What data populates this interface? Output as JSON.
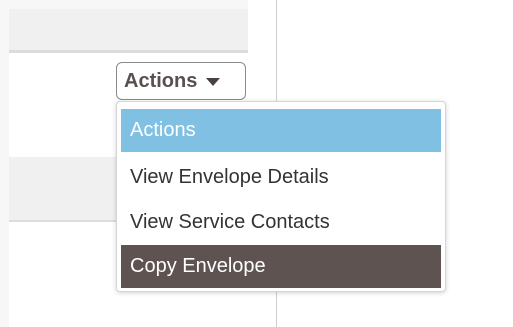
{
  "actions_button": {
    "label": "Actions"
  },
  "menu": {
    "items": [
      {
        "label": "Actions",
        "state": "highlighted"
      },
      {
        "label": "View Envelope Details",
        "state": "normal"
      },
      {
        "label": "View Service Contacts",
        "state": "normal"
      },
      {
        "label": "Copy Envelope",
        "state": "selected"
      }
    ]
  },
  "colors": {
    "highlight": "#7fc0e3",
    "selected": "#5f5352",
    "button_text": "#5a4f4f"
  }
}
